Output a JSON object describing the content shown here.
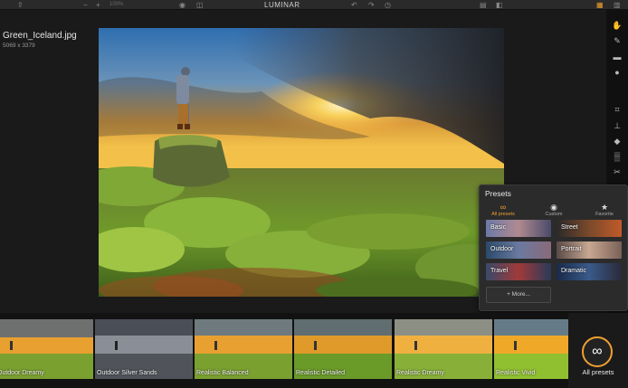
{
  "app": {
    "title": "LUMINAR",
    "zoom_label": "100%"
  },
  "file": {
    "name": "Green_Iceland.jpg",
    "dimensions": "5069 x 3379"
  },
  "toolbar_icons": [
    "share-icon",
    "zoom-out-icon",
    "zoom-in-icon",
    "eye-icon",
    "compare-icon",
    "undo-icon",
    "redo-icon",
    "history-icon",
    "layers-icon",
    "adjust-icon",
    "presets-icon",
    "settings-icon"
  ],
  "tool_rail": [
    "hand-icon",
    "brush-icon",
    "gradient-icon",
    "radial-mask-icon",
    "crop-icon",
    "clone-stamp-icon",
    "eraser-icon",
    "noise-icon",
    "transform-icon"
  ],
  "presets_panel": {
    "title": "Presets",
    "tabs": [
      {
        "label": "All presets",
        "icon": "infinity-icon",
        "active": true
      },
      {
        "label": "Custom",
        "icon": "user-icon",
        "active": false
      },
      {
        "label": "Favorite",
        "icon": "star-icon",
        "active": false
      }
    ],
    "categories": [
      "Basic",
      "Street",
      "Outdoor",
      "Portrait",
      "Travel",
      "Dramatic"
    ],
    "more_label": "+ More..."
  },
  "filmstrip": {
    "presets": [
      "Outdoor Dreamy",
      "Outdoor Silver Sands",
      "Realistic Balanced",
      "Realistic Detailed",
      "Realistic Dreamy",
      "Realistic Vivid"
    ],
    "all_presets_label": "All presets"
  },
  "colors": {
    "accent": "#f0a030",
    "background": "#1a1a1a",
    "panel": "#2b2b2b"
  }
}
